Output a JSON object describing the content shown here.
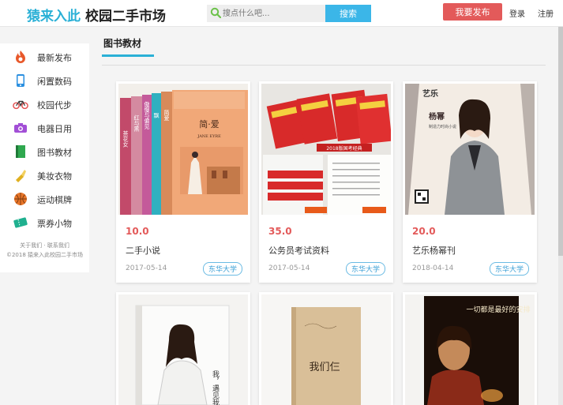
{
  "header": {
    "brand": "猿来入此",
    "title": "校园二手市场",
    "search_placeholder": "搜点什么吧...",
    "search_button": "搜索",
    "publish_button": "我要发布",
    "login": "登录",
    "register": "注册"
  },
  "sidebar": {
    "items": [
      {
        "label": "最新发布",
        "icon": "flame-icon",
        "color": "#e8582a"
      },
      {
        "label": "闲置数码",
        "icon": "phone-icon",
        "color": "#2a8fe0"
      },
      {
        "label": "校园代步",
        "icon": "bicycle-icon",
        "color": "#e35050"
      },
      {
        "label": "电器日用",
        "icon": "camera-icon",
        "color": "#a24fd6"
      },
      {
        "label": "图书教材",
        "icon": "book-icon",
        "color": "#2fa84f"
      },
      {
        "label": "美妆衣物",
        "icon": "lipstick-icon",
        "color": "#e0b020"
      },
      {
        "label": "运动棋牌",
        "icon": "basketball-icon",
        "color": "#e8762a"
      },
      {
        "label": "票券小物",
        "icon": "ticket-icon",
        "color": "#1fb08f"
      }
    ],
    "footer_line1": "关于我们 · 联系我们",
    "footer_line2": "©2018 猿来入此校园二手市场"
  },
  "section": {
    "title": "图书教材"
  },
  "products": [
    {
      "price": "10.0",
      "title": "二手小说",
      "date": "2017-05-14",
      "school": "东华大学",
      "image": "novel-books"
    },
    {
      "price": "35.0",
      "title": "公务员考试资料",
      "date": "2017-05-14",
      "school": "东华大学",
      "image": "exam-books"
    },
    {
      "price": "20.0",
      "title": "艺乐杨幂刊",
      "date": "2018-04-14",
      "school": "东华大学",
      "image": "magazine-cover"
    },
    {
      "image": "book-cover-woman"
    },
    {
      "image": "book-cover-beige"
    },
    {
      "image": "book-cover-man"
    }
  ],
  "book_texts": {
    "jane_eyre": "简·爱",
    "jane_eyre_en": "JANE EYRE",
    "spine1": "红与黑",
    "spine2": "傲慢与偏见",
    "spine3": "飘",
    "spine4": "简爱",
    "spine5": "茶花女",
    "exam_banner": "2018版国考经典",
    "magazine_name": "杨幂",
    "magazine_sub": "制造力时尚小说",
    "magazine_logo": "艺乐",
    "book4_title": "我，遇见我",
    "book5_title": "我们仨",
    "book6_title": "一切都是最好的安排"
  }
}
